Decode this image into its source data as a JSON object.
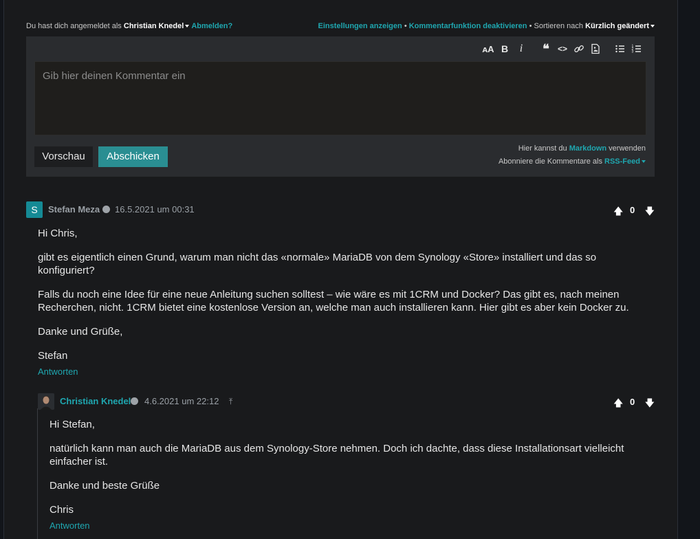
{
  "login": {
    "prefix": "Du hast dich angemeldet als",
    "user": "Christian Knedel",
    "logout": "Abmelden?",
    "settings": "Einstellungen anzeigen",
    "bullet1": "•",
    "disable": "Kommentarfunktion deaktivieren",
    "bullet2": "•",
    "sort_prefix": "Sortieren nach",
    "sort_value": "Kürzlich geändert"
  },
  "editor": {
    "placeholder": "Gib hier deinen Kommentar ein",
    "preview_label": "Vorschau",
    "submit_label": "Abschicken",
    "hint_markdown_prefix": "Hier kannst du",
    "hint_markdown_link": "Markdown",
    "hint_markdown_suffix": "verwenden",
    "hint_rss_prefix": "Abonniere die Kommentare als",
    "hint_rss_link": "RSS-Feed",
    "toolbar": {
      "text_size": "ᴀA",
      "bold": "B",
      "italic": "i",
      "quote": "❝",
      "code": "<>"
    }
  },
  "comments": [
    {
      "avatar_letter": "S",
      "author": "Stefan Meza",
      "date": "16.5.2021 um 00:31",
      "votes": "0",
      "paragraphs": [
        "Hi Chris,",
        "gibt es eigentlich einen Grund, warum man nicht das «normale» MariaDB von dem Synology «Store» installiert und das so konfiguriert?",
        "Falls du noch eine Idee für eine neue Anleitung suchen solltest – wie wäre es mit 1CRM und Docker? Das gibt es, nach meinen Recherchen, nicht. 1CRM bietet eine kostenlose Version an, welche man auch installieren kann. Hier gibt es aber kein Docker zu.",
        "Danke und Grüße,",
        "Stefan"
      ],
      "reply": "Antworten"
    },
    {
      "author": "Christian Knedel",
      "date": "4.6.2021 um 22:12",
      "votes": "0",
      "paragraphs": [
        "Hi Stefan,",
        "natürlich kann man auch die MariaDB aus dem Synology-Store nehmen. Doch ich dachte, dass diese Installationsart vielleicht einfacher ist.",
        "Danke und beste Grüße",
        "Chris"
      ],
      "reply": "Antworten"
    }
  ],
  "colors": {
    "accent": "#1fa7b0",
    "submit": "#2a8e92",
    "background": "#191a1c",
    "editor_bg": "#2a2c2f"
  }
}
